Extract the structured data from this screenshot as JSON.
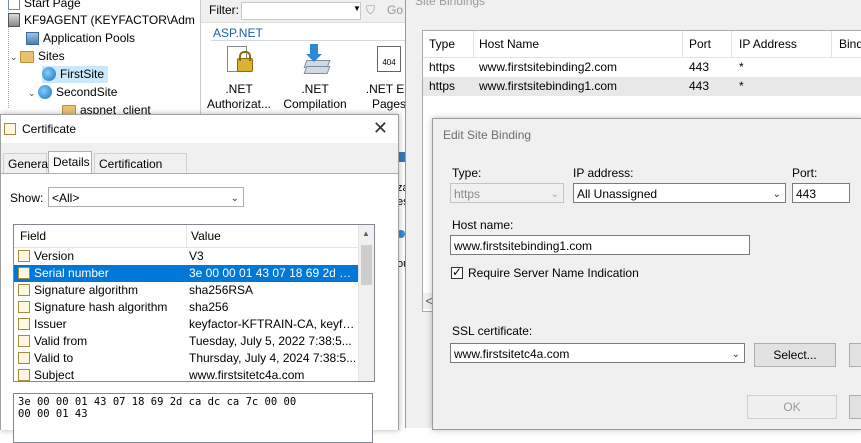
{
  "iis_tree": {
    "items": [
      {
        "label": "Start Page"
      },
      {
        "label": "KF9AGENT (KEYFACTOR\\Adm"
      },
      {
        "label": "Application Pools"
      },
      {
        "label": "Sites"
      },
      {
        "label": "FirstSite"
      },
      {
        "label": "SecondSite"
      },
      {
        "label": "aspnet_client"
      }
    ]
  },
  "features_pane": {
    "filter_label": "Filter:",
    "go_label": "Go",
    "group_title": "ASP.NET",
    "features": [
      {
        "label_line1": ".NET",
        "label_line2": "Authorizat..."
      },
      {
        "label_line1": ".NET",
        "label_line2": "Compilation"
      },
      {
        "label_line1": ".NET Err",
        "label_line2": "Pages"
      }
    ],
    "partial_labels": [
      "za",
      "es",
      "ou"
    ]
  },
  "site_bindings": {
    "title": "Site Bindings",
    "columns": [
      "Type",
      "Host Name",
      "Port",
      "IP Address",
      "Bind"
    ],
    "rows": [
      {
        "type": "https",
        "host": "www.firstsitebinding2.com",
        "port": "443",
        "ip": "*"
      },
      {
        "type": "https",
        "host": "www.firstsitebinding1.com",
        "port": "443",
        "ip": "*"
      }
    ],
    "scroll_left_glyph": "<"
  },
  "edit_binding": {
    "title": "Edit Site Binding",
    "type_label": "Type:",
    "type_value": "https",
    "ip_label": "IP address:",
    "ip_value": "All Unassigned",
    "port_label": "Port:",
    "port_value": "443",
    "host_label": "Host name:",
    "host_value": "www.firstsitebinding1.com",
    "sni_label": "Require Server Name Indication",
    "sni_checked": true,
    "ssl_label": "SSL certificate:",
    "ssl_value": "www.firstsitetc4a.com",
    "select_button": "Select...",
    "ok_button": "OK"
  },
  "certificate": {
    "title": "Certificate",
    "tabs": [
      {
        "label": "General"
      },
      {
        "label": "Details"
      },
      {
        "label": "Certification Path"
      }
    ],
    "active_tab": "Details",
    "show_label": "Show:",
    "show_value": "<All>",
    "columns": [
      "Field",
      "Value"
    ],
    "fields": [
      {
        "field": "Version",
        "value": "V3"
      },
      {
        "field": "Serial number",
        "value": "3e 00 00 01 43 07 18 69 2d ca..."
      },
      {
        "field": "Signature algorithm",
        "value": "sha256RSA"
      },
      {
        "field": "Signature hash algorithm",
        "value": "sha256"
      },
      {
        "field": "Issuer",
        "value": "keyfactor-KFTRAIN-CA, keyfa..."
      },
      {
        "field": "Valid from",
        "value": "Tuesday, July 5, 2022 7:38:5..."
      },
      {
        "field": "Valid to",
        "value": "Thursday, July 4, 2024 7:38:5..."
      },
      {
        "field": "Subject",
        "value": "www.firstsitetc4a.com"
      }
    ],
    "selected_field": "Serial number",
    "hex_value": "3e 00 00 01 43 07 18 69 2d ca dc ca 7c 00 00\n00 00 01 43"
  },
  "colors": {
    "selection_blue": "#0078d7",
    "tree_selection": "#cce8ff",
    "dialog_bg": "#f0f0f0",
    "aspnet_header": "#1a5fb4"
  }
}
